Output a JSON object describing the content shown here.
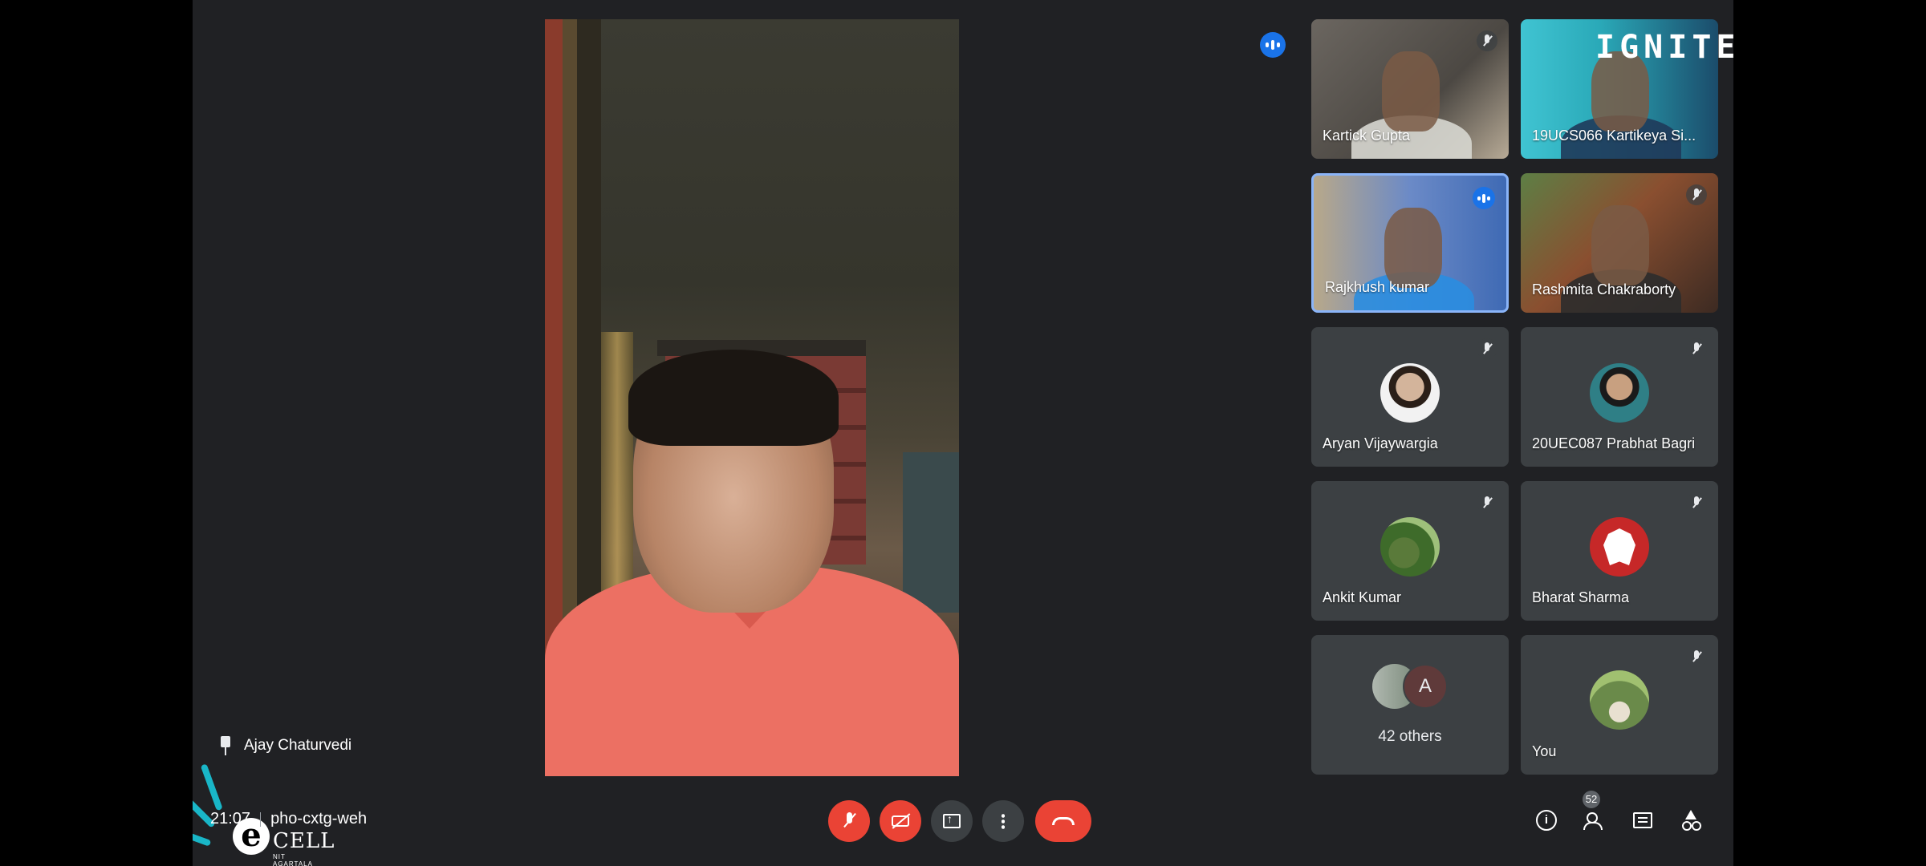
{
  "main_speaker": {
    "name": "Ajay Chaturvedi"
  },
  "meeting": {
    "time": "21:07",
    "code": "pho-cxtg-weh"
  },
  "watermark": "IGNITE",
  "logo": {
    "text": "CELL",
    "subtext": "NIT AGARTALA",
    "letter": "e"
  },
  "participants": [
    {
      "name": "Kartick Gupta",
      "muted": true,
      "type": "video"
    },
    {
      "name": "19UCS066 Kartikeya Si...",
      "muted": false,
      "type": "video"
    },
    {
      "name": "Rajkhush kumar",
      "muted": false,
      "speaking": true,
      "type": "video"
    },
    {
      "name": "Rashmita Chakraborty",
      "muted": true,
      "type": "video"
    },
    {
      "name": "Aryan Vijaywargia",
      "muted": true,
      "type": "avatar"
    },
    {
      "name": "20UEC087 Prabhat Bagri",
      "muted": true,
      "type": "avatar"
    },
    {
      "name": "Ankit Kumar",
      "muted": true,
      "type": "avatar"
    },
    {
      "name": "Bharat Sharma",
      "muted": true,
      "type": "avatar"
    }
  ],
  "others_tile": {
    "initial": "A",
    "label": "42 others"
  },
  "you_tile": {
    "name": "You",
    "muted": true
  },
  "controls": {
    "mic": "mic-off",
    "camera": "camera-off",
    "present": "present-now",
    "more": "more-options",
    "end_call": "leave-call"
  },
  "side_controls": {
    "info": "i",
    "people_count": "52"
  },
  "colors": {
    "background": "#202124",
    "tile": "#3c4043",
    "danger": "#ea4335",
    "accent": "#1a73e8"
  }
}
